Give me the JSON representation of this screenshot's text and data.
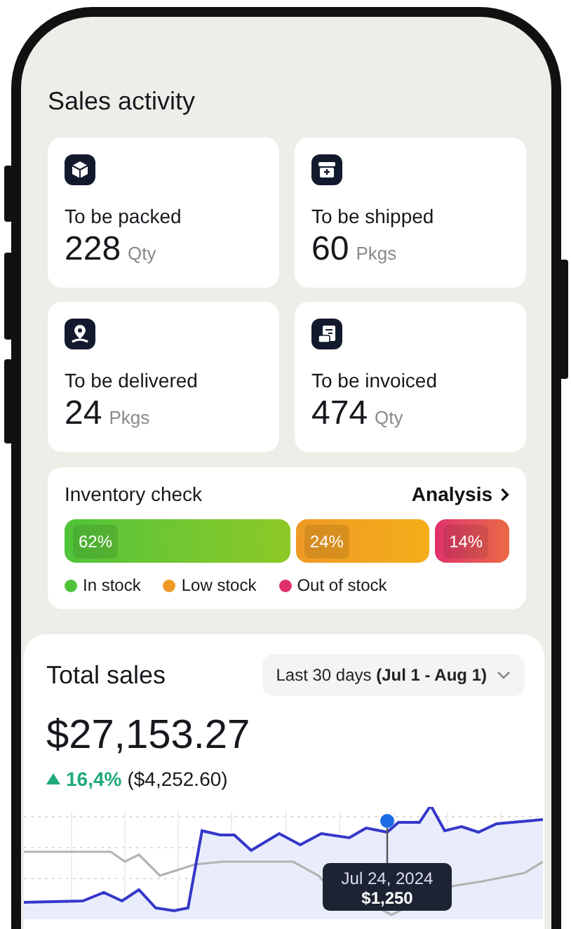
{
  "section_title": "Sales activity",
  "activity_cards": [
    {
      "kind": "box",
      "label": "To be packed",
      "value": "228",
      "unit": "Qty"
    },
    {
      "kind": "store",
      "label": "To be shipped",
      "value": "60",
      "unit": "Pkgs"
    },
    {
      "kind": "location",
      "label": "To be delivered",
      "value": "24",
      "unit": "Pkgs"
    },
    {
      "kind": "invoice",
      "label": "To be invoiced",
      "value": "474",
      "unit": "Qty"
    }
  ],
  "inventory": {
    "title": "Inventory check",
    "link": "Analysis",
    "segments": [
      {
        "percent": "62%",
        "label": "In stock",
        "color": "#4fc43a"
      },
      {
        "percent": "24%",
        "label": "Low stock",
        "color": "#ee9a25"
      },
      {
        "percent": "14%",
        "label": "Out of stock",
        "color": "#e0306a"
      }
    ]
  },
  "sales": {
    "title": "Total sales",
    "range": "Last 30 days **(Jul 1 - Aug 1)**",
    "amount": "$27,153.27",
    "change_percent": "16,4%",
    "change_amount": "($4,252.60)",
    "tooltip": {
      "date": "Jul 24, 2024",
      "value": "$1,250"
    }
  }
}
